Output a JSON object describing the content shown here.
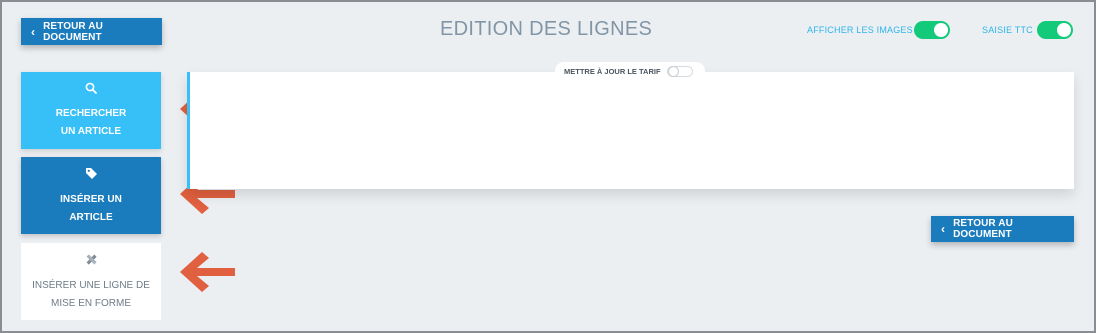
{
  "header": {
    "back_label": "RETOUR AU DOCUMENT",
    "title": "EDITION DES LIGNES",
    "show_images_label": "AFFICHER LES IMAGES",
    "show_images_on": true,
    "ttc_label": "SAISIE TTC",
    "ttc_on": true
  },
  "sidebar": {
    "search": {
      "line1": "RECHERCHER",
      "line2": "UN ARTICLE",
      "icon": "search-icon"
    },
    "insert": {
      "line1": "INSÉRER UN",
      "line2": "ARTICLE",
      "icon": "tag-icon"
    },
    "format": {
      "line1": "INSÉRER UNE LIGNE DE",
      "line2": "MISE EN FORME",
      "icon": "pencil-ruler-icon"
    }
  },
  "panel": {
    "tarif_label": "METTRE À JOUR LE TARIF",
    "tarif_on": false
  },
  "footer": {
    "back_label": "RETOUR AU DOCUMENT"
  },
  "colors": {
    "primary": "#1a7bbd",
    "accent": "#36c0f7",
    "toggle_on": "#13c97a",
    "arrow": "#e0603f",
    "title": "#8295a6"
  }
}
